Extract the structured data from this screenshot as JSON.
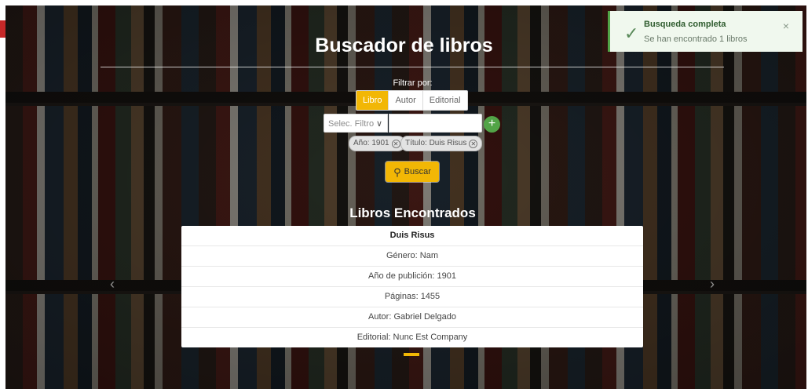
{
  "page_title": "Buscador de libros",
  "filter": {
    "label": "Filtrar por:",
    "options": [
      "Libro",
      "Autor",
      "Editorial"
    ],
    "active": "Libro",
    "select_placeholder": "Selec. Filtro",
    "input_value": "",
    "add_symbol": "+"
  },
  "tags": [
    "Año: 1901",
    "Título: Duis Risus"
  ],
  "search_button": "Buscar",
  "results": {
    "heading": "Libros Encontrados",
    "rows": [
      "Duis Risus",
      "Género: Nam",
      "Año de publición: 1901",
      "Páginas: 1455",
      "Autor: Gabriel Delgado",
      "Editorial: Nunc Est Company"
    ]
  },
  "toast": {
    "title": "Busqueda completa",
    "message": "Se han encontrado 1 libros",
    "close": "×"
  },
  "carousel": {
    "prev": "‹",
    "next": "›"
  },
  "colors": {
    "accent": "#f2b705",
    "success": "#52a447"
  },
  "icons": [
    "check-icon",
    "close-icon",
    "chevron-down-icon",
    "plus-icon",
    "search-icon",
    "clear-circle-icon"
  ]
}
